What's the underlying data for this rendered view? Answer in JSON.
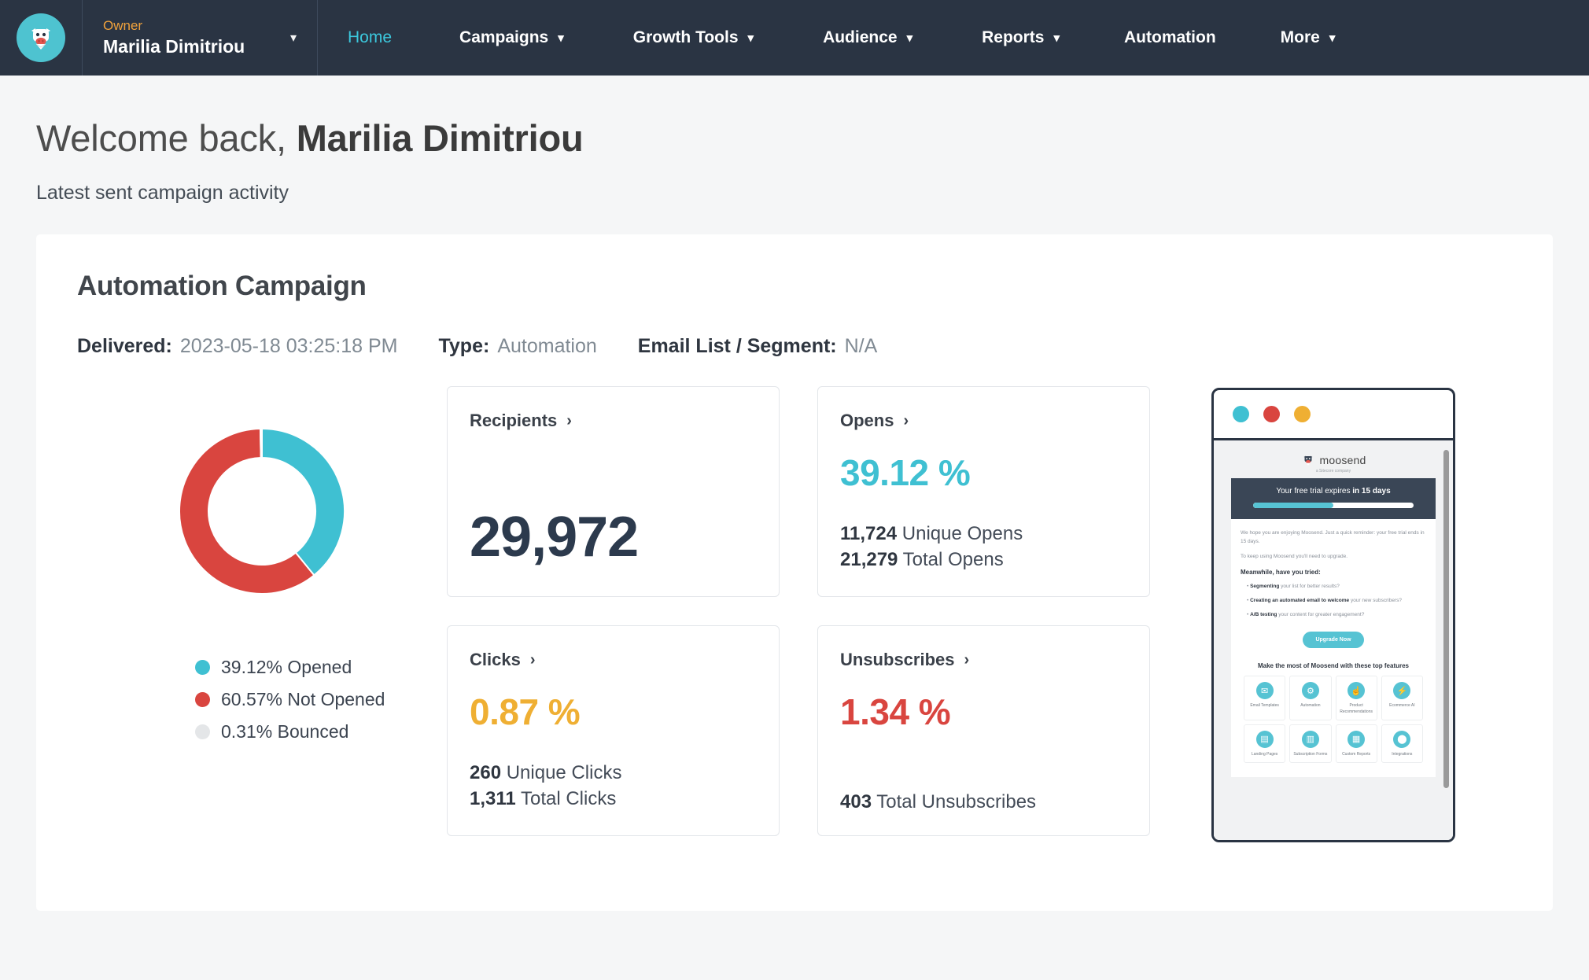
{
  "topnav": {
    "logo_icon": "moosend-cow-logo-icon",
    "account": {
      "role": "Owner",
      "name": "Marilia Dimitriou",
      "caret_icon": "chevron-down-icon"
    },
    "items": [
      {
        "label": "Home",
        "has_dropdown": false,
        "active": true
      },
      {
        "label": "Campaigns",
        "has_dropdown": true,
        "active": false
      },
      {
        "label": "Growth Tools",
        "has_dropdown": true,
        "active": false
      },
      {
        "label": "Audience",
        "has_dropdown": true,
        "active": false
      },
      {
        "label": "Reports",
        "has_dropdown": true,
        "active": false
      },
      {
        "label": "Automation",
        "has_dropdown": false,
        "active": false
      },
      {
        "label": "More",
        "has_dropdown": true,
        "active": false
      }
    ],
    "bg_color": "#2a3443",
    "active_color": "#3cc8dd",
    "role_color": "#f0a23c"
  },
  "page": {
    "welcome_prefix": "Welcome back, ",
    "welcome_name": "Marilia Dimitriou",
    "subtitle": "Latest sent campaign activity"
  },
  "campaign": {
    "title": "Automation Campaign",
    "meta": [
      {
        "label": "Delivered:",
        "value": "2023-05-18 03:25:18 PM"
      },
      {
        "label": "Type:",
        "value": "Automation"
      },
      {
        "label": "Email List / Segment:",
        "value": "N/A"
      }
    ]
  },
  "chart_data": {
    "type": "pie",
    "title": "",
    "categories": [
      "Opened",
      "Not Opened",
      "Bounced"
    ],
    "values": [
      39.12,
      60.57,
      0.31
    ],
    "unit": "%",
    "colors": [
      "#3fc0d2",
      "#d9453f",
      "#e4e6e8"
    ],
    "legend": [
      {
        "label": "39.12% Opened",
        "color": "#3fc0d2"
      },
      {
        "label": "60.57% Not Opened",
        "color": "#d9453f"
      },
      {
        "label": "0.31% Bounced",
        "color": "#e4e6e8"
      }
    ],
    "legend_position": "bottom-left",
    "donut": true,
    "start_angle_deg": 0,
    "direction": "clockwise"
  },
  "cards": {
    "recipients": {
      "title": "Recipients",
      "chevron_icon": "chevron-right-icon",
      "value": "29,972"
    },
    "opens": {
      "title": "Opens",
      "chevron_icon": "chevron-right-icon",
      "percent": "39.12 %",
      "percent_color": "#3fc0d2",
      "lines": [
        {
          "number": "11,724",
          "label": "Unique Opens"
        },
        {
          "number": "21,279",
          "label": "Total Opens"
        }
      ]
    },
    "clicks": {
      "title": "Clicks",
      "chevron_icon": "chevron-right-icon",
      "percent": "0.87 %",
      "percent_color": "#efaf33",
      "lines": [
        {
          "number": "260",
          "label": "Unique Clicks"
        },
        {
          "number": "1,311",
          "label": "Total Clicks"
        }
      ]
    },
    "unsubscribes": {
      "title": "Unsubscribes",
      "chevron_icon": "chevron-right-icon",
      "percent": "1.34 %",
      "percent_color": "#d9453f",
      "lines": [
        {
          "number": "403",
          "label": "Total Unsubscribes"
        }
      ]
    }
  },
  "preview": {
    "window_dots": [
      "#3fc0d2",
      "#d9453f",
      "#efaf33"
    ],
    "logo_word": "moosend",
    "logo_tagline": "a Sitecore company",
    "trial_text_prefix": "Your free trial expires ",
    "trial_text_bold": "in 15 days",
    "trial_progress_percent": 50,
    "paragraph_1": "We hope you are enjoying Moosend. Just a quick reminder: your free trial ends in 15 days.",
    "paragraph_2": "To keep using Moosend you'll need to upgrade.",
    "list_heading": "Meanwhile, have you tried:",
    "list_items": [
      {
        "bold": "Segmenting",
        "rest": " your list for better results?"
      },
      {
        "bold": "Creating an automated email to welcome",
        "rest": " your new subscribers?"
      },
      {
        "bold": "A/B testing",
        "rest": " your content for greater engagement?"
      }
    ],
    "cta_label": "Upgrade Now",
    "features_title": "Make the most of Moosend with these top features",
    "features": [
      {
        "label": "Email Templates",
        "icon": "template-icon",
        "glyph": "✉"
      },
      {
        "label": "Automation",
        "icon": "gears-icon",
        "glyph": "⚙"
      },
      {
        "label": "Product Recommendations",
        "icon": "thumbs-up-icon",
        "glyph": "☝"
      },
      {
        "label": "Ecommerce AI",
        "icon": "bolt-icon",
        "glyph": "⚡"
      },
      {
        "label": "Landing Pages",
        "icon": "page-icon",
        "glyph": "▤"
      },
      {
        "label": "Subscription Forms",
        "icon": "form-icon",
        "glyph": "▥"
      },
      {
        "label": "Custom Reports",
        "icon": "report-icon",
        "glyph": "▦"
      },
      {
        "label": "Integrations",
        "icon": "plug-icon",
        "glyph": "⬤"
      }
    ]
  }
}
